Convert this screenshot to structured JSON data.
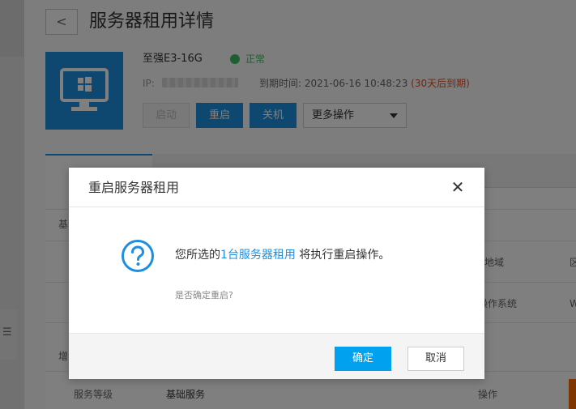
{
  "page": {
    "back_icon": "chevron-left-icon",
    "title": "服务器租用详情",
    "server_name": "至强E3-16G",
    "status": "正常",
    "ip_label": "IP:",
    "expire_label": "到期时间:",
    "expire_date": "2021-06-16 10:48:23",
    "expire_warning": "(30天后到期)",
    "actions": {
      "start": "启动",
      "restart": "重启",
      "shutdown": "关机",
      "more": "更多操作"
    },
    "bg_text": {
      "row1_left": "基",
      "row1_right_a": "地域",
      "row1_right_b": "区",
      "row2_right_a": "操作系统",
      "row2_right_b": "W",
      "row3_left": "增",
      "service_level_label": "服务等级",
      "service_level_value": "基础服务",
      "operation_label": "操作"
    }
  },
  "modal": {
    "title": "重启服务器租用",
    "close_icon": "close-icon",
    "message_prefix": "您所选的",
    "message_highlight": "1台服务器租用",
    "message_suffix": " 将执行重启操作。",
    "confirm_question": "是否确定重启?",
    "ok_label": "确定",
    "cancel_label": "取消"
  },
  "colors": {
    "accent": "#1d8fe0",
    "ok_button": "#00a2ef",
    "status_green": "#3fbf5e",
    "warning_red": "#e64b1e",
    "orange": "#ff6a00"
  }
}
